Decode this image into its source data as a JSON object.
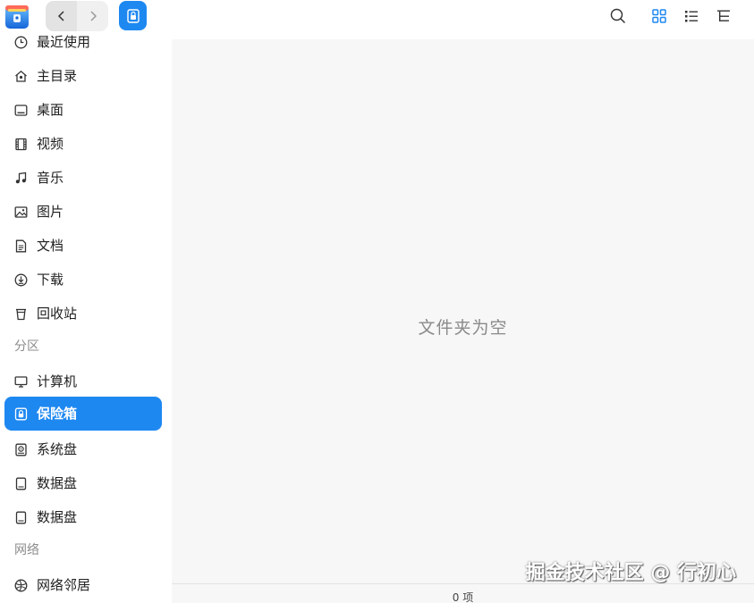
{
  "colors": {
    "accent": "#1e88f1",
    "sidebar_bg": "#ffffff",
    "main_bg": "#f7f7f8",
    "muted_text": "#8a8a8a"
  },
  "toolbar": {
    "app_icon": "file-manager-logo-icon",
    "back_icon": "chevron-left-icon",
    "forward_icon": "chevron-right-icon",
    "breadcrumb_icon": "vault-lock-icon",
    "actions": [
      "search-icon",
      "icon-view-icon",
      "list-view-icon",
      "tree-view-icon"
    ]
  },
  "sidebar": {
    "items": [
      {
        "label": "最近使用",
        "icon": "clock-icon"
      },
      {
        "label": "主目录",
        "icon": "home-icon"
      },
      {
        "label": "桌面",
        "icon": "desktop-icon"
      },
      {
        "label": "视频",
        "icon": "video-icon"
      },
      {
        "label": "音乐",
        "icon": "music-icon"
      },
      {
        "label": "图片",
        "icon": "image-icon"
      },
      {
        "label": "文档",
        "icon": "document-icon"
      },
      {
        "label": "下载",
        "icon": "download-icon"
      },
      {
        "label": "回收站",
        "icon": "trash-icon"
      }
    ],
    "partition_header": "分区",
    "partitions": [
      {
        "label": "计算机",
        "icon": "computer-icon",
        "active": false
      },
      {
        "label": "保险箱",
        "icon": "vault-icon",
        "active": true
      },
      {
        "label": "系统盘",
        "icon": "system-disk-icon",
        "active": false
      },
      {
        "label": "数据盘",
        "icon": "disk-icon",
        "active": false
      },
      {
        "label": "数据盘",
        "icon": "disk-icon",
        "active": false
      }
    ],
    "network_header": "网络",
    "network": [
      {
        "label": "网络邻居",
        "icon": "network-icon"
      }
    ]
  },
  "main": {
    "empty_message": "文件夹为空",
    "watermark": "掘金技术社区 @ 行初心"
  },
  "status": {
    "item_count": "0 项"
  }
}
